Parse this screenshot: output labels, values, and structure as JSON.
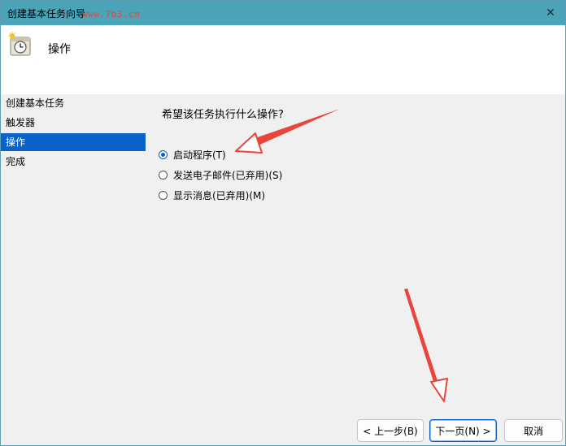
{
  "window": {
    "title": "创建基本任务向导",
    "watermark": "www.7b3.cn",
    "close_glyph": "✕"
  },
  "header": {
    "title": "操作",
    "icon": "task-clock-icon"
  },
  "sidebar": {
    "items": [
      {
        "label": "创建基本任务",
        "selected": false
      },
      {
        "label": "触发器",
        "selected": false
      },
      {
        "label": "操作",
        "selected": true
      },
      {
        "label": "完成",
        "selected": false
      }
    ]
  },
  "main": {
    "question": "希望该任务执行什么操作?",
    "options": [
      {
        "label": "启动程序(T)",
        "checked": true
      },
      {
        "label": "发送电子邮件(已弃用)(S)",
        "checked": false
      },
      {
        "label": "显示消息(已弃用)(M)",
        "checked": false
      }
    ]
  },
  "buttons": {
    "back": "< 上一步(B)",
    "next": "下一页(N) >",
    "cancel": "取消"
  },
  "colors": {
    "titlebar": "#4aa3b6",
    "selection": "#0a62c8",
    "annotation_arrow": "#e8453c"
  }
}
